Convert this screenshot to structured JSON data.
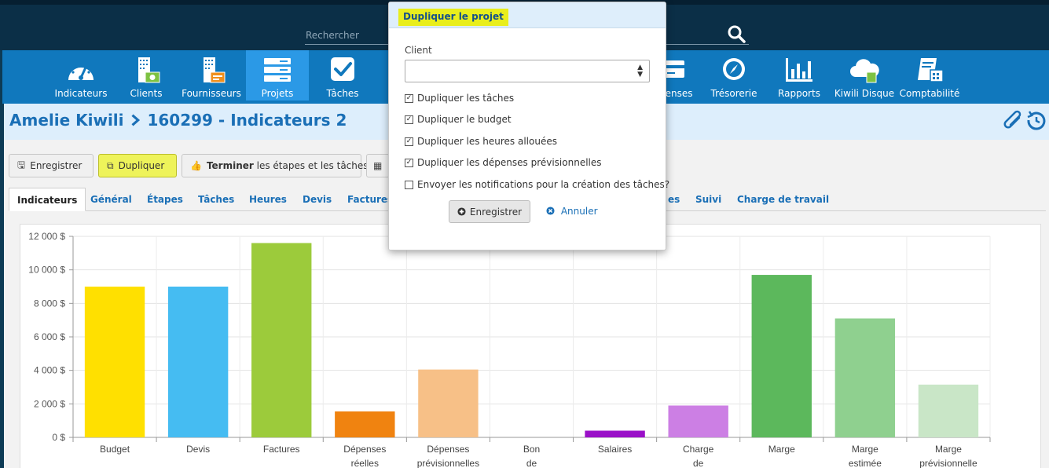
{
  "search": {
    "placeholder": "Rechercher"
  },
  "nav": {
    "items": [
      {
        "label": "Indicateurs",
        "icon": "speedometer-icon"
      },
      {
        "label": "Clients",
        "icon": "building-money-icon"
      },
      {
        "label": "Fournisseurs",
        "icon": "building-invoice-icon"
      },
      {
        "label": "Projets",
        "icon": "server-stack-icon"
      },
      {
        "label": "Tâches",
        "icon": "checkbox-icon"
      },
      {
        "label": "penses",
        "icon": "credit-card-icon"
      },
      {
        "label": "Trésorerie",
        "icon": "compass-icon"
      },
      {
        "label": "Rapports",
        "icon": "bar-chart-icon"
      },
      {
        "label": "Kiwili Disque",
        "icon": "cloud-icon"
      },
      {
        "label": "Comptabilité",
        "icon": "ledger-icon"
      }
    ]
  },
  "breadcrumb": {
    "client": "Amelie Kiwili",
    "project": "160299 - Indicateurs 2"
  },
  "toolbar": {
    "save_label": "Enregistrer",
    "duplicate_label": "Dupliquer",
    "finish_bold": "Terminer",
    "finish_rest": " les étapes et les tâches"
  },
  "tabs": [
    "Indicateurs",
    "Général",
    "Étapes",
    "Tâches",
    "Heures",
    "Devis",
    "Factures",
    "es",
    "Suivi",
    "Charge de travail"
  ],
  "chart_data": {
    "type": "bar",
    "categories": [
      "Budget",
      "Devis",
      "Factures",
      "Dépenses réelles",
      "Dépenses prévisionnelles",
      "Bon de",
      "Salaires",
      "Charge de",
      "Marge",
      "Marge estimée",
      "Marge prévisionnelle"
    ],
    "values": [
      9000,
      9000,
      11600,
      1550,
      4050,
      0,
      400,
      1900,
      9700,
      7100,
      3150
    ],
    "colors": [
      "#ffe000",
      "#45bcf2",
      "#9ccb3b",
      "#f08310",
      "#f7c087",
      "#cccccc",
      "#9a0fc8",
      "#cc7fe4",
      "#5cb85c",
      "#8fd08f",
      "#c9e6c7"
    ],
    "yticks": [
      "0 $",
      "2 000 $",
      "4 000 $",
      "6 000 $",
      "8 000 $",
      "10 000 $",
      "12 000 $"
    ],
    "ylim": [
      0,
      12000
    ],
    "grid": true
  },
  "modal": {
    "title": "Dupliquer le projet",
    "client_label": "Client",
    "options": [
      {
        "label": "Dupliquer les tâches",
        "checked": true
      },
      {
        "label": "Dupliquer le budget",
        "checked": true
      },
      {
        "label": "Dupliquer les heures allouées",
        "checked": true
      },
      {
        "label": "Dupliquer les dépenses prévisionnelles",
        "checked": true
      },
      {
        "label": "Envoyer les notifications pour la création des tâches?",
        "checked": false
      }
    ],
    "save_label": "Enregistrer",
    "cancel_label": "Annuler"
  }
}
